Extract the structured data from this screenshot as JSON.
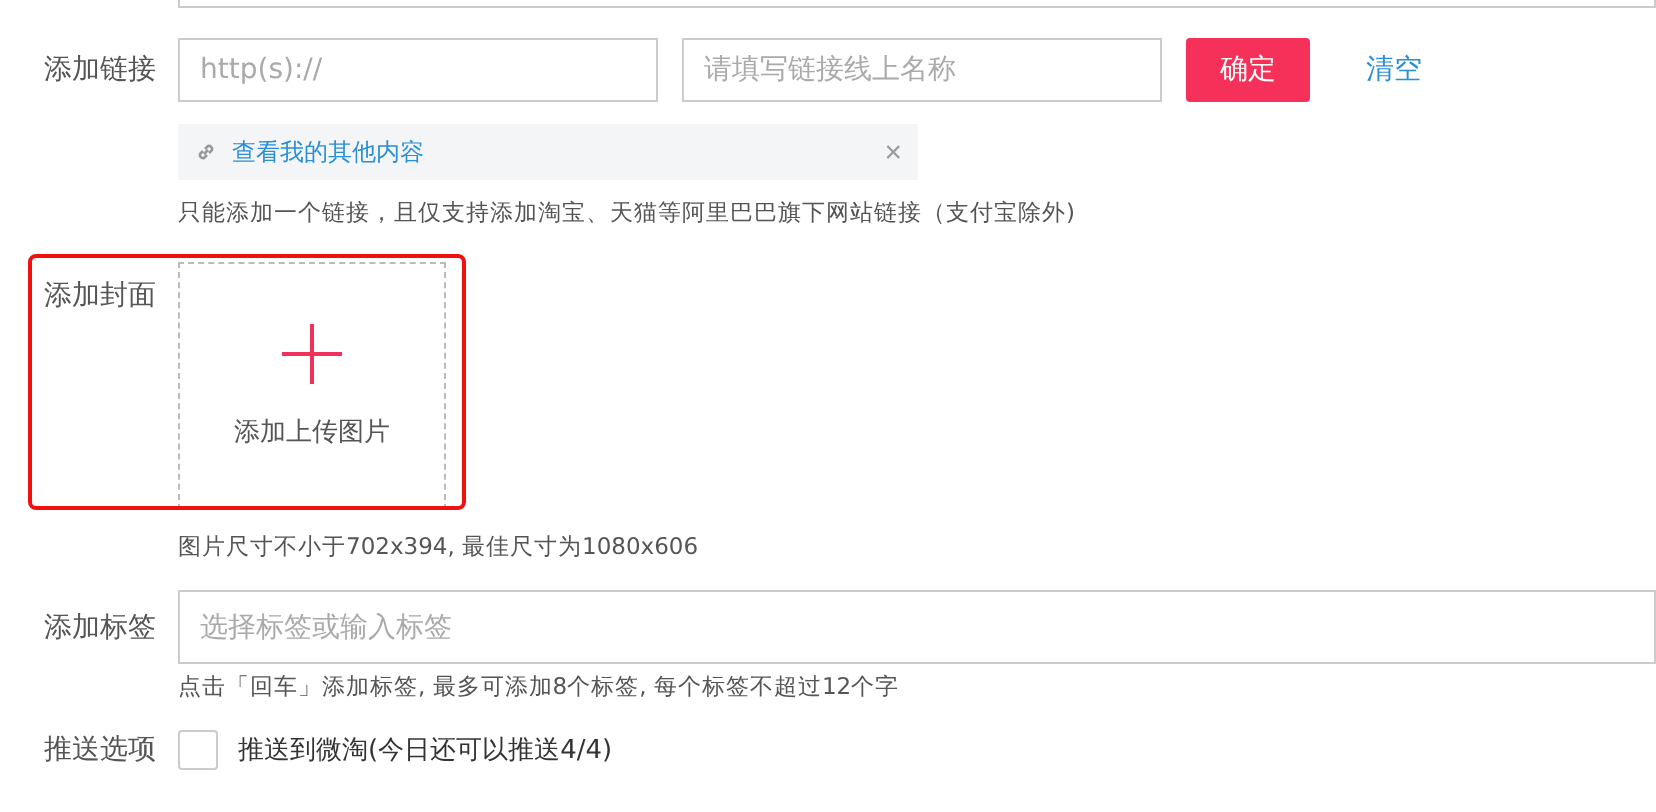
{
  "link_section": {
    "label": "添加链接",
    "url_field": {
      "placeholder": "http(s)://"
    },
    "name_field": {
      "placeholder": "请填写链接线上名称"
    },
    "confirm_button": "确定",
    "clear_link": "清空",
    "attached_link": {
      "text": "查看我的其他内容",
      "remove": "×"
    },
    "hint": "只能添加一个链接，且仅支持添加淘宝、天猫等阿里巴巴旗下网站链接（支付宝除外)"
  },
  "cover_section": {
    "label": "添加封面",
    "highlighted": true,
    "upload_label": "添加上传图片",
    "hint": "图片尺寸不小于702x394, 最佳尺寸为1080x606"
  },
  "tags_section": {
    "label": "添加标签",
    "tag_field": {
      "placeholder": "选择标签或输入标签"
    },
    "hint": "点击「回车」添加标签, 最多可添加8个标签, 每个标签不超过12个字"
  },
  "push_section": {
    "label": "推送选项",
    "option": {
      "text": "推送到微淘(今日还可以推送4/4)",
      "checked": false
    }
  }
}
